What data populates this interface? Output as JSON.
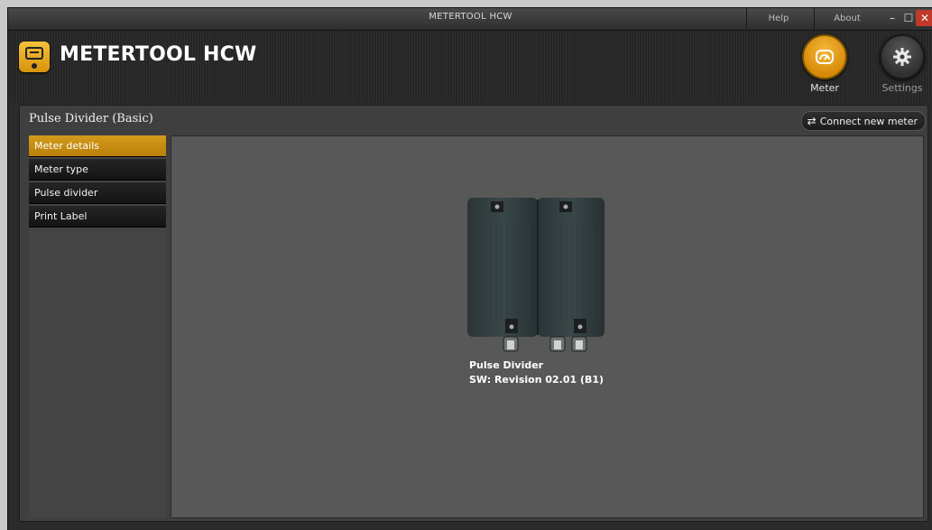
{
  "window": {
    "title": "METERTOOL HCW",
    "help_label": "Help",
    "about_label": "About",
    "minimize": "–",
    "maximize": "☐",
    "close": "✕"
  },
  "header": {
    "app_name": "METERTOOL HCW",
    "nav": [
      {
        "label": "Meter",
        "icon": "gauge-icon",
        "active": true
      },
      {
        "label": "Settings",
        "icon": "gear-icon",
        "active": false
      }
    ]
  },
  "panel": {
    "title": "Pulse Divider  (Basic)",
    "connect_label": "Connect new meter"
  },
  "sidebar": {
    "items": [
      {
        "label": "Meter details",
        "active": true
      },
      {
        "label": "Meter type",
        "active": false
      },
      {
        "label": "Pulse divider",
        "active": false
      },
      {
        "label": "Print Label",
        "active": false
      }
    ]
  },
  "device": {
    "name": "Pulse Divider",
    "sw": "SW: Revision 02.01 (B1)"
  },
  "colors": {
    "accent": "#d49a1a",
    "background": "#3f3f3f",
    "content": "#585858"
  }
}
